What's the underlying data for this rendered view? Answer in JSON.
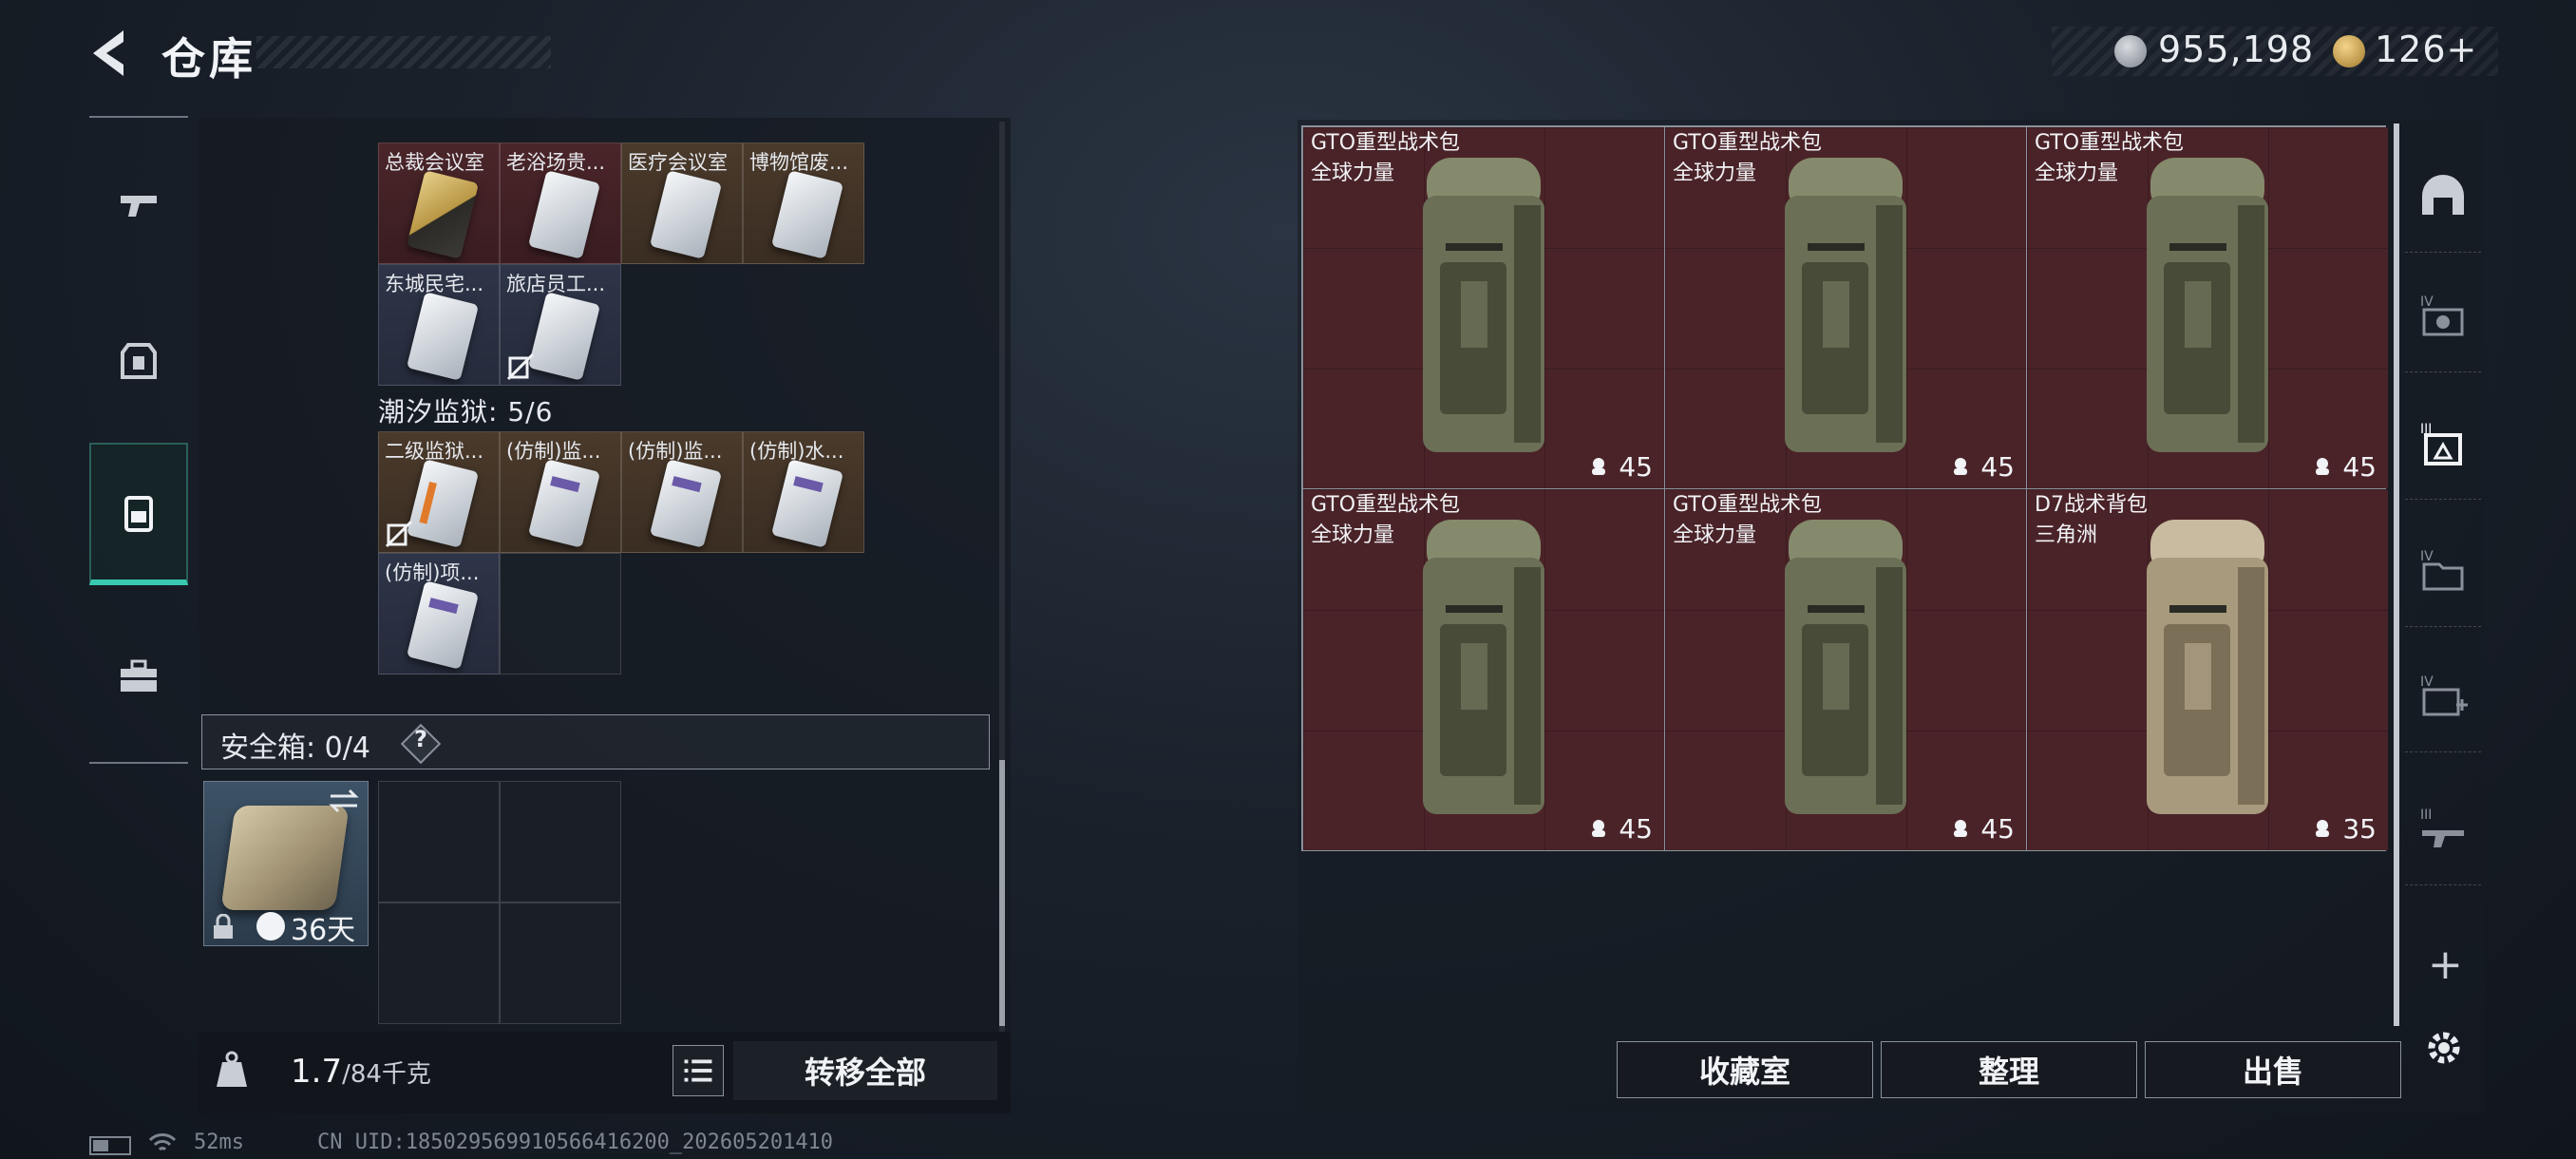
{
  "header": {
    "title": "仓库",
    "currency_silver": "955,198",
    "currency_gold": "126+"
  },
  "left_rail": {
    "items": [
      {
        "icon": "gun-icon",
        "active": false
      },
      {
        "icon": "armor-icon",
        "active": false
      },
      {
        "icon": "backpack-icon",
        "active": true
      },
      {
        "icon": "toolbox-icon",
        "active": false
      }
    ]
  },
  "inventory": {
    "group1_cards": [
      "总裁会议室",
      "老浴场贵...",
      "医疗会议室",
      "博物馆废...",
      "东城民宅...",
      "旅店员工..."
    ],
    "group2_title": "潮汐监狱: 5/6",
    "group2_cards": [
      "二级监狱...",
      "(仿制)监...",
      "(仿制)监...",
      "(仿制)水...",
      "(仿制)项..."
    ],
    "safe_label": "安全箱: 0/4",
    "help": "?",
    "safe_days": "36天",
    "weight_value": "1.7",
    "weight_max": "/84千克",
    "transfer_all": "转移全部"
  },
  "stash": {
    "items": [
      {
        "name": "GTO重型战术包",
        "source": "全球力量",
        "count": "45",
        "tone": "olive"
      },
      {
        "name": "GTO重型战术包",
        "source": "全球力量",
        "count": "45",
        "tone": "olive"
      },
      {
        "name": "GTO重型战术包",
        "source": "全球力量",
        "count": "45",
        "tone": "olive"
      },
      {
        "name": "GTO重型战术包",
        "source": "全球力量",
        "count": "45",
        "tone": "olive"
      },
      {
        "name": "GTO重型战术包",
        "source": "全球力量",
        "count": "45",
        "tone": "olive"
      },
      {
        "name": "D7战术背包",
        "source": "三角洲",
        "count": "35",
        "tone": "tan"
      }
    ],
    "buttons": {
      "collection": "收藏室",
      "organize": "整理",
      "sell": "出售"
    }
  },
  "status_bar": {
    "ping": "52ms",
    "uid": "CN UID:185029569910566416200_202605201410"
  },
  "colors": {
    "accent_teal": "#38c9b0",
    "item_red": "#4a2328"
  }
}
